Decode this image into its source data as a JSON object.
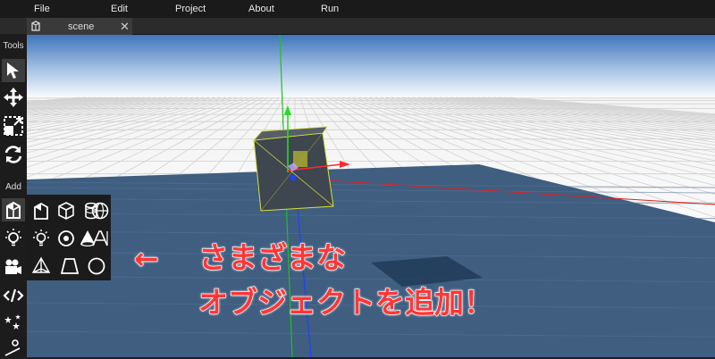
{
  "menu": {
    "items": [
      "File",
      "Edit",
      "Project",
      "About",
      "Run"
    ]
  },
  "tabs": [
    {
      "label": "scene",
      "close": "✕"
    }
  ],
  "toolbar": {
    "tools_label": "Tools",
    "tools": [
      "select-arrow-icon",
      "move-icon",
      "scale-icon",
      "rotate-icon"
    ],
    "add_label": "Add"
  },
  "add_panel": {
    "items": [
      "model-icon",
      "cube-icon",
      "cylinder-icon",
      "sphere-icon",
      "point-light-icon",
      "spot-light-icon",
      "cone-icon",
      "text-icon",
      "camera-icon",
      "pyramid-icon",
      "plane-icon",
      "circle-icon"
    ]
  },
  "extra_tools": [
    "script-icon",
    "particles-icon",
    "sky-icon"
  ],
  "annotation": {
    "arrow": "←",
    "line1": "さまざまな",
    "line2": "オブジェクトを追加！"
  },
  "colors": {
    "sky_top": "#3f75bb",
    "sky_bottom": "#ffffff",
    "floor": "#3f5e80",
    "axis_x": "#e02020",
    "axis_y": "#20c020",
    "axis_z": "#2040ff",
    "annotation_text": "#ff3636"
  }
}
